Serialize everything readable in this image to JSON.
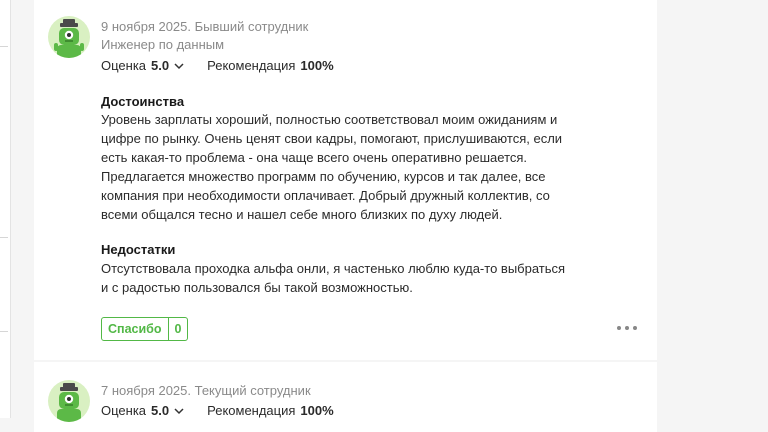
{
  "reviews": [
    {
      "date_status": "9 ноября 2025. Бывший сотрудник",
      "position": "Инженер по данным",
      "rating_label": "Оценка",
      "rating_value": "5.0",
      "recommend_label": "Рекомендация",
      "recommend_value": "100%",
      "pros_title": "Достоинства",
      "pros_text": "Уровень зарплаты хороший, полностью соответствовал моим ожиданиям и цифре по рынку. Очень ценят свои кадры, помогают, прислушиваются, если есть какая-то проблема - она чаще всего очень оперативно решается. Предлагается множество программ по обучению, курсов и так далее, все компания при необходимости оплачивает. Добрый дружный коллектив, со всеми общался тесно и нашел себе много близких по духу людей.",
      "cons_title": "Недостатки",
      "cons_text": "Отсутствовала проходка альфа онли, я частенько люблю куда-то выбраться и с радостью пользовался бы такой возможностью.",
      "helpful_label": "Спасибо",
      "helpful_count": "0"
    },
    {
      "date_status": "7 ноября 2025. Текущий сотрудник",
      "rating_label": "Оценка",
      "rating_value": "5.0",
      "recommend_label": "Рекомендация",
      "recommend_value": "100%"
    }
  ],
  "icons": {
    "avatar": "green-robot-avatar-icon",
    "chevron": "chevron-down-icon",
    "more": "more-dots-icon"
  },
  "colors": {
    "accent": "#52b846",
    "avatar_bg": "#d9f0c2",
    "muted_text": "#8a8a8a"
  }
}
